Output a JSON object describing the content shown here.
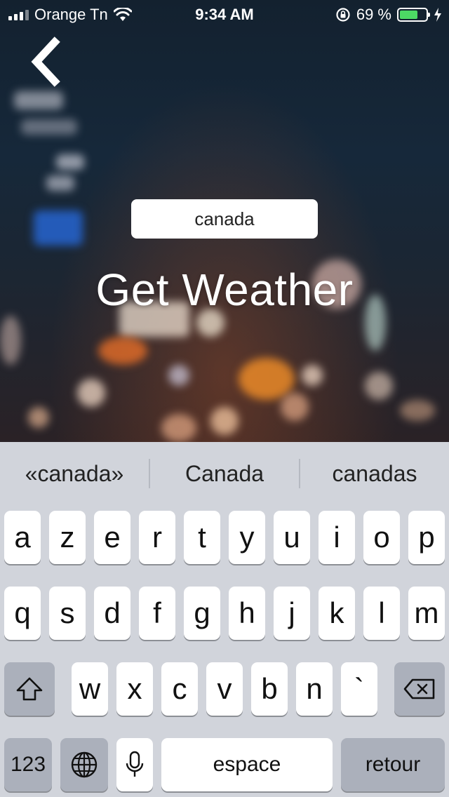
{
  "status_bar": {
    "carrier": "Orange Tn",
    "time": "9:34 AM",
    "battery_percent": "69 %",
    "battery_level": 0.69,
    "battery_color": "#4cd964"
  },
  "screen": {
    "search_value": "canada",
    "title": "Get Weather"
  },
  "keyboard": {
    "suggestions": [
      "«canada»",
      "Canada",
      "canadas"
    ],
    "row1": [
      "a",
      "z",
      "e",
      "r",
      "t",
      "y",
      "u",
      "i",
      "o",
      "p"
    ],
    "row2": [
      "q",
      "s",
      "d",
      "f",
      "g",
      "h",
      "j",
      "k",
      "l",
      "m"
    ],
    "row3": [
      "w",
      "x",
      "c",
      "v",
      "b",
      "n",
      "`"
    ],
    "numbers_label": "123",
    "space_label": "espace",
    "return_label": "retour"
  }
}
